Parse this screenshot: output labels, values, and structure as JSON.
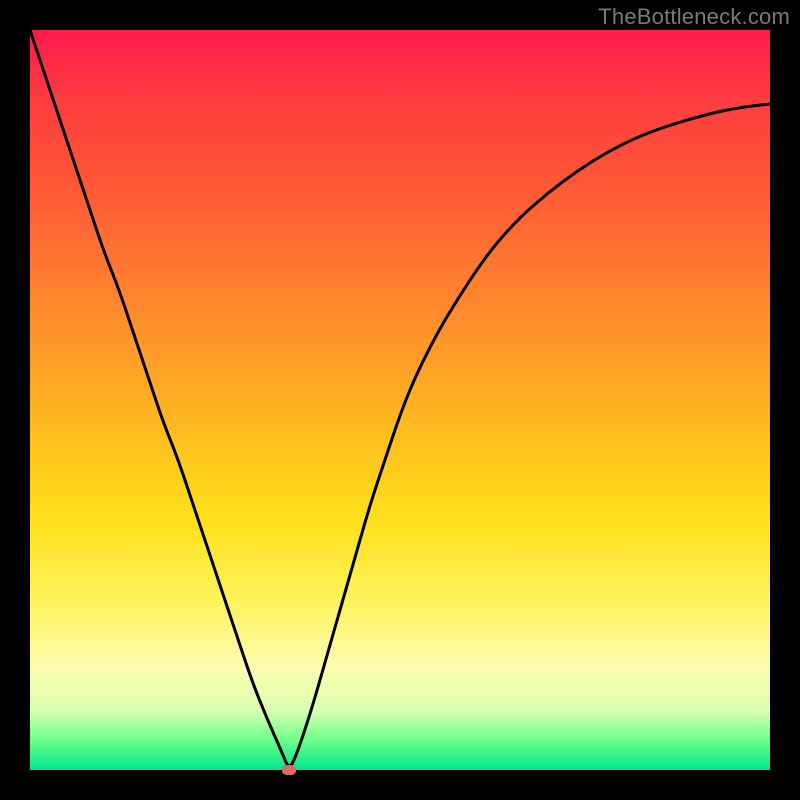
{
  "watermark": "TheBottleneck.com",
  "chart_data": {
    "type": "line",
    "title": "",
    "xlabel": "",
    "ylabel": "",
    "xlim": [
      0,
      100
    ],
    "ylim": [
      0,
      100
    ],
    "grid": false,
    "legend": false,
    "x": [
      0,
      2,
      4,
      6,
      8,
      10,
      12,
      14,
      16,
      18,
      20,
      22,
      24,
      26,
      28,
      30,
      32,
      34,
      35,
      36,
      38,
      40,
      42,
      44,
      46,
      48,
      50,
      52,
      55,
      58,
      62,
      66,
      70,
      74,
      78,
      82,
      86,
      90,
      94,
      98,
      100
    ],
    "values": [
      100,
      94,
      88,
      82,
      76,
      70,
      65,
      59,
      53,
      47,
      42,
      36,
      30,
      24,
      18,
      12,
      7,
      2.5,
      0,
      2,
      8,
      15,
      22,
      29,
      36,
      42,
      48,
      53,
      59,
      64,
      70,
      74.5,
      78,
      81,
      83.5,
      85.5,
      87,
      88.2,
      89.2,
      89.8,
      90
    ],
    "marker": {
      "x": 35,
      "y": 0,
      "shape": "rounded-rect",
      "color": "#d96b5f"
    },
    "line_color": "#000000",
    "line_width": 3,
    "background_gradient": {
      "direction": "vertical",
      "stops": [
        {
          "pos": 0.0,
          "color": "#ff1a4d"
        },
        {
          "pos": 0.22,
          "color": "#ff5a36"
        },
        {
          "pos": 0.53,
          "color": "#ffb81f"
        },
        {
          "pos": 0.77,
          "color": "#fdf35a"
        },
        {
          "pos": 0.96,
          "color": "#6bff8c"
        },
        {
          "pos": 1.0,
          "color": "#00e68e"
        }
      ]
    }
  }
}
